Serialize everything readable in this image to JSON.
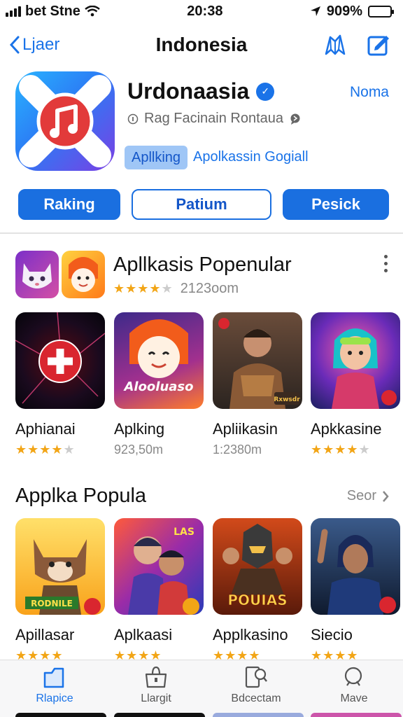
{
  "status_bar": {
    "carrier": "bet Stne",
    "time": "20:38",
    "battery": "909%",
    "battery_level": 0.9
  },
  "nav": {
    "back_label": "Ljaer",
    "title": "Indonesia"
  },
  "app": {
    "name": "Urdonaasia",
    "action_link": "Noma",
    "subtitle": "Rag Facinain Rontaua",
    "chip": "Apllking",
    "chip_link": "Apolkassin Gogiall",
    "buttons": [
      "Raking",
      "Patium",
      "Pesick"
    ]
  },
  "popular": {
    "title": "Apllkasis Popenular",
    "rating": 3.5,
    "count": "2123oom",
    "items": [
      {
        "name": "Aphianai",
        "rating": 3.5,
        "meta": ""
      },
      {
        "name": "Aplking",
        "meta": "923,50m"
      },
      {
        "name": "Apliikasin",
        "meta": "1:2380m"
      },
      {
        "name": "Apkkasine",
        "rating": 4,
        "meta": ""
      }
    ],
    "thumb_texts": [
      "Alooluaso",
      "Rxwsdr"
    ]
  },
  "section2": {
    "title": "Applka Popula",
    "see_all": "Seor",
    "items": [
      {
        "name": "Apillasar",
        "badge": "RODNILE"
      },
      {
        "name": "Aplkaasi",
        "badge": "LAS"
      },
      {
        "name": "Applkasino",
        "badge": "POUIAS"
      },
      {
        "name": "Siecio",
        "badge": ""
      }
    ]
  },
  "tabbar": {
    "items": [
      {
        "label": "Rlapice",
        "icon": "apps-icon",
        "active": true
      },
      {
        "label": "Llargit",
        "icon": "bag-icon",
        "active": false
      },
      {
        "label": "Bdcectam",
        "icon": "search-doc-icon",
        "active": false
      },
      {
        "label": "Mave",
        "icon": "search-icon",
        "active": false
      }
    ]
  },
  "colors": {
    "accent": "#1a73e8",
    "primary_button": "#1a6fe0",
    "star": "#f2a516"
  }
}
